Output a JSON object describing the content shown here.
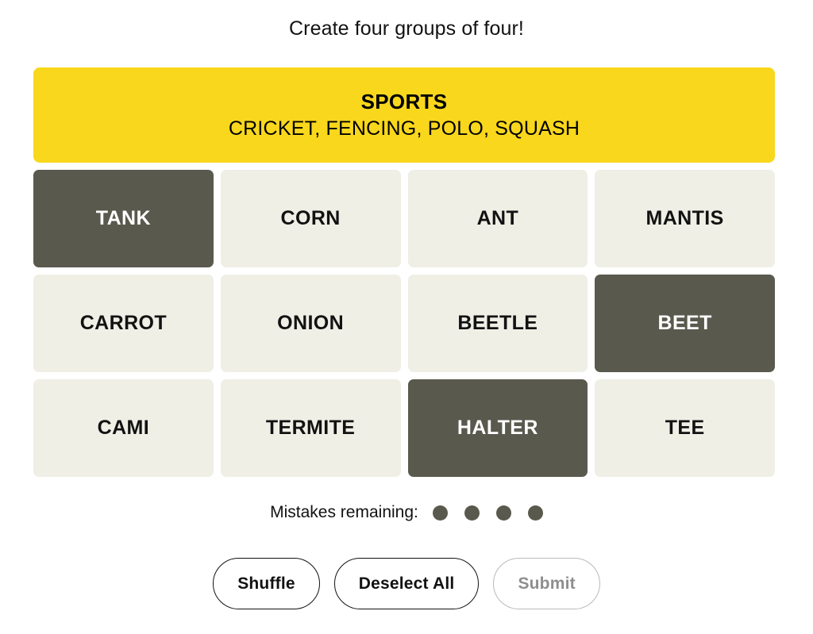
{
  "page": {
    "title": "Create four groups of four!",
    "background_color": "#ffffff"
  },
  "solved_groups": [
    {
      "name": "SPORTS",
      "words_line": "CRICKET, FENCING, POLO, SQUASH",
      "color": "#f9d71c",
      "difficulty": "yellow"
    }
  ],
  "grid": {
    "columns": 4,
    "rows": 3,
    "tiles": [
      {
        "label": "TANK",
        "selected": true
      },
      {
        "label": "CORN",
        "selected": false
      },
      {
        "label": "ANT",
        "selected": false
      },
      {
        "label": "MANTIS",
        "selected": false
      },
      {
        "label": "CARROT",
        "selected": false
      },
      {
        "label": "ONION",
        "selected": false
      },
      {
        "label": "BEETLE",
        "selected": false
      },
      {
        "label": "BEET",
        "selected": true
      },
      {
        "label": "CAMI",
        "selected": false
      },
      {
        "label": "TERMITE",
        "selected": false
      },
      {
        "label": "HALTER",
        "selected": true
      },
      {
        "label": "TEE",
        "selected": false
      }
    ],
    "selected_color": "#5a594e",
    "unselected_color": "#efefe6"
  },
  "mistakes": {
    "label": "Mistakes remaining:",
    "remaining": 4,
    "dot_color": "#5a594e"
  },
  "controls": {
    "shuffle_label": "Shuffle",
    "deselect_label": "Deselect All",
    "submit_label": "Submit",
    "submit_disabled": true
  }
}
